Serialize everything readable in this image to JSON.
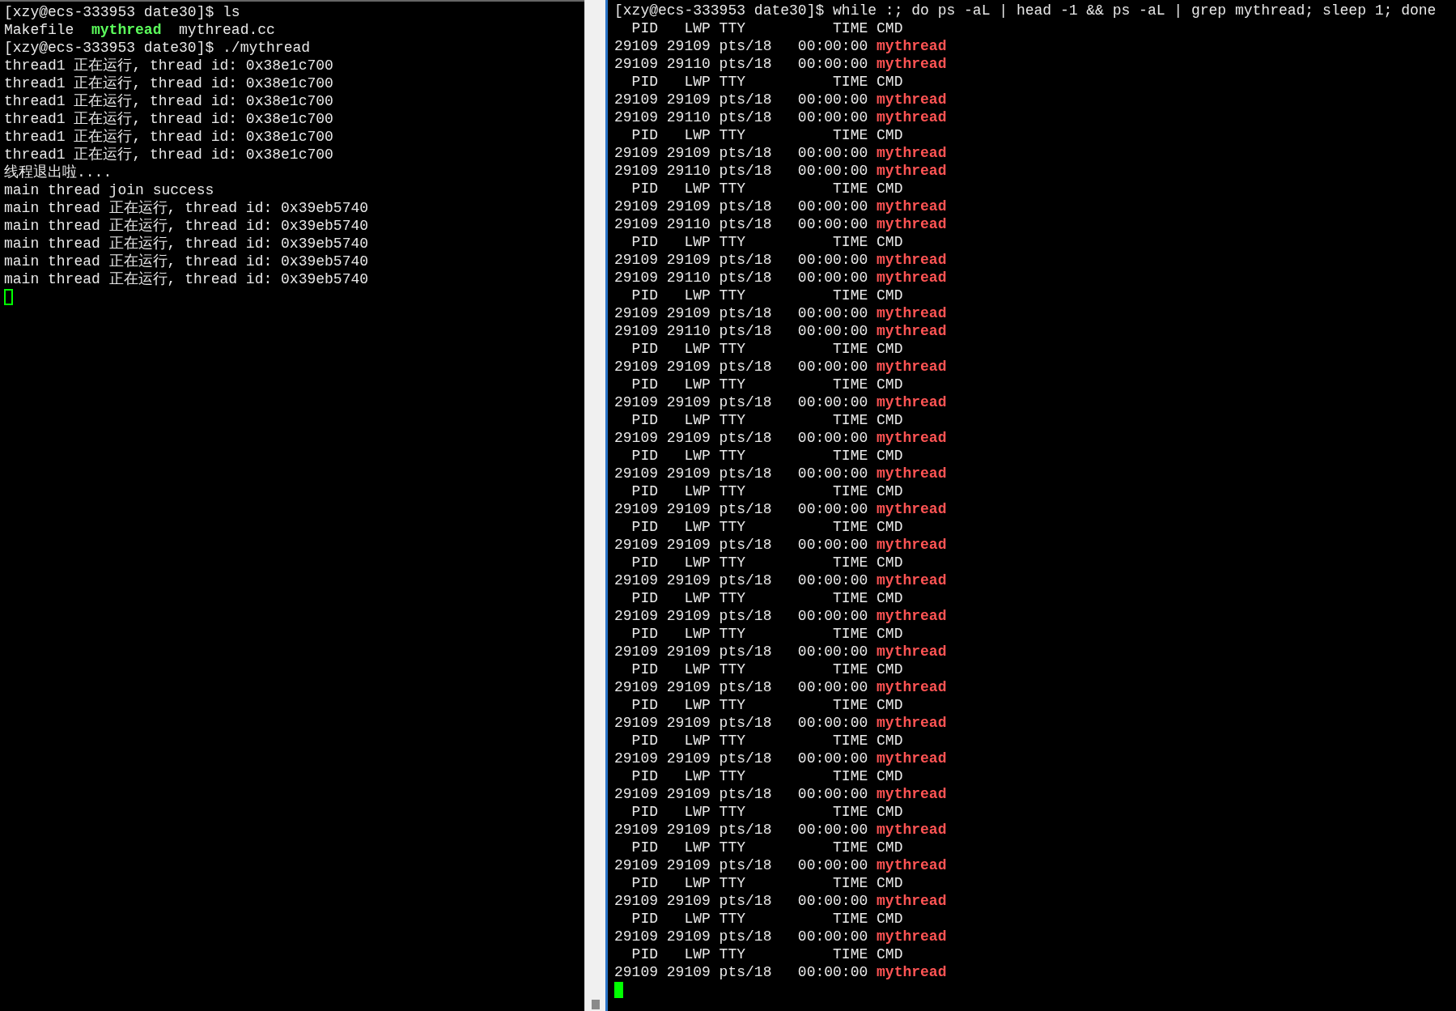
{
  "left_pane": {
    "lines": [
      [
        {
          "text": "[xzy@ecs-333953 date30]$ ls",
          "kind": "plain"
        }
      ],
      [
        {
          "text": "Makefile",
          "kind": "plain"
        },
        {
          "text": "mythread",
          "kind": "exec"
        },
        {
          "text": "mythread.cc",
          "kind": "plain"
        }
      ],
      [
        {
          "text": "[xzy@ecs-333953 date30]$ ./mythread",
          "kind": "plain"
        }
      ],
      [
        {
          "text": "thread1 正在运行, thread id: 0x38e1c700",
          "kind": "plain"
        }
      ],
      [
        {
          "text": "thread1 正在运行, thread id: 0x38e1c700",
          "kind": "plain"
        }
      ],
      [
        {
          "text": "thread1 正在运行, thread id: 0x38e1c700",
          "kind": "plain"
        }
      ],
      [
        {
          "text": "thread1 正在运行, thread id: 0x38e1c700",
          "kind": "plain"
        }
      ],
      [
        {
          "text": "thread1 正在运行, thread id: 0x38e1c700",
          "kind": "plain"
        }
      ],
      [
        {
          "text": "thread1 正在运行, thread id: 0x38e1c700",
          "kind": "plain"
        }
      ],
      [
        {
          "text": "线程退出啦....",
          "kind": "plain"
        }
      ],
      [
        {
          "text": "main thread join success",
          "kind": "plain"
        }
      ],
      [
        {
          "text": "main thread 正在运行, thread id: 0x39eb5740",
          "kind": "plain"
        }
      ],
      [
        {
          "text": "main thread 正在运行, thread id: 0x39eb5740",
          "kind": "plain"
        }
      ],
      [
        {
          "text": "main thread 正在运行, thread id: 0x39eb5740",
          "kind": "plain"
        }
      ],
      [
        {
          "text": "main thread 正在运行, thread id: 0x39eb5740",
          "kind": "plain"
        }
      ],
      [
        {
          "text": "main thread 正在运行, thread id: 0x39eb5740",
          "kind": "plain"
        }
      ]
    ],
    "cursor": {
      "filled": false
    }
  },
  "right_pane": {
    "lines": [
      [
        {
          "text": "[xzy@ecs-333953 date30]$ while :; do ps -aL | head -1 && ps -aL | grep mythread; sleep 1; done",
          "kind": "plain"
        }
      ],
      [
        {
          "text": "  PID   LWP TTY          TIME CMD",
          "kind": "plain"
        }
      ],
      [
        {
          "text": "29109 29109 pts/18   00:00:00 ",
          "kind": "plain"
        },
        {
          "text": "mythread",
          "kind": "proc"
        }
      ],
      [
        {
          "text": "29109 29110 pts/18   00:00:00 ",
          "kind": "plain"
        },
        {
          "text": "mythread",
          "kind": "proc"
        }
      ],
      [
        {
          "text": "  PID   LWP TTY          TIME CMD",
          "kind": "plain"
        }
      ],
      [
        {
          "text": "29109 29109 pts/18   00:00:00 ",
          "kind": "plain"
        },
        {
          "text": "mythread",
          "kind": "proc"
        }
      ],
      [
        {
          "text": "29109 29110 pts/18   00:00:00 ",
          "kind": "plain"
        },
        {
          "text": "mythread",
          "kind": "proc"
        }
      ],
      [
        {
          "text": "  PID   LWP TTY          TIME CMD",
          "kind": "plain"
        }
      ],
      [
        {
          "text": "29109 29109 pts/18   00:00:00 ",
          "kind": "plain"
        },
        {
          "text": "mythread",
          "kind": "proc"
        }
      ],
      [
        {
          "text": "29109 29110 pts/18   00:00:00 ",
          "kind": "plain"
        },
        {
          "text": "mythread",
          "kind": "proc"
        }
      ],
      [
        {
          "text": "  PID   LWP TTY          TIME CMD",
          "kind": "plain"
        }
      ],
      [
        {
          "text": "29109 29109 pts/18   00:00:00 ",
          "kind": "plain"
        },
        {
          "text": "mythread",
          "kind": "proc"
        }
      ],
      [
        {
          "text": "29109 29110 pts/18   00:00:00 ",
          "kind": "plain"
        },
        {
          "text": "mythread",
          "kind": "proc"
        }
      ],
      [
        {
          "text": "  PID   LWP TTY          TIME CMD",
          "kind": "plain"
        }
      ],
      [
        {
          "text": "29109 29109 pts/18   00:00:00 ",
          "kind": "plain"
        },
        {
          "text": "mythread",
          "kind": "proc"
        }
      ],
      [
        {
          "text": "29109 29110 pts/18   00:00:00 ",
          "kind": "plain"
        },
        {
          "text": "mythread",
          "kind": "proc"
        }
      ],
      [
        {
          "text": "  PID   LWP TTY          TIME CMD",
          "kind": "plain"
        }
      ],
      [
        {
          "text": "29109 29109 pts/18   00:00:00 ",
          "kind": "plain"
        },
        {
          "text": "mythread",
          "kind": "proc"
        }
      ],
      [
        {
          "text": "29109 29110 pts/18   00:00:00 ",
          "kind": "plain"
        },
        {
          "text": "mythread",
          "kind": "proc"
        }
      ],
      [
        {
          "text": "  PID   LWP TTY          TIME CMD",
          "kind": "plain"
        }
      ],
      [
        {
          "text": "29109 29109 pts/18   00:00:00 ",
          "kind": "plain"
        },
        {
          "text": "mythread",
          "kind": "proc"
        }
      ],
      [
        {
          "text": "  PID   LWP TTY          TIME CMD",
          "kind": "plain"
        }
      ],
      [
        {
          "text": "29109 29109 pts/18   00:00:00 ",
          "kind": "plain"
        },
        {
          "text": "mythread",
          "kind": "proc"
        }
      ],
      [
        {
          "text": "  PID   LWP TTY          TIME CMD",
          "kind": "plain"
        }
      ],
      [
        {
          "text": "29109 29109 pts/18   00:00:00 ",
          "kind": "plain"
        },
        {
          "text": "mythread",
          "kind": "proc"
        }
      ],
      [
        {
          "text": "  PID   LWP TTY          TIME CMD",
          "kind": "plain"
        }
      ],
      [
        {
          "text": "29109 29109 pts/18   00:00:00 ",
          "kind": "plain"
        },
        {
          "text": "mythread",
          "kind": "proc"
        }
      ],
      [
        {
          "text": "  PID   LWP TTY          TIME CMD",
          "kind": "plain"
        }
      ],
      [
        {
          "text": "29109 29109 pts/18   00:00:00 ",
          "kind": "plain"
        },
        {
          "text": "mythread",
          "kind": "proc"
        }
      ],
      [
        {
          "text": "  PID   LWP TTY          TIME CMD",
          "kind": "plain"
        }
      ],
      [
        {
          "text": "29109 29109 pts/18   00:00:00 ",
          "kind": "plain"
        },
        {
          "text": "mythread",
          "kind": "proc"
        }
      ],
      [
        {
          "text": "  PID   LWP TTY          TIME CMD",
          "kind": "plain"
        }
      ],
      [
        {
          "text": "29109 29109 pts/18   00:00:00 ",
          "kind": "plain"
        },
        {
          "text": "mythread",
          "kind": "proc"
        }
      ],
      [
        {
          "text": "  PID   LWP TTY          TIME CMD",
          "kind": "plain"
        }
      ],
      [
        {
          "text": "29109 29109 pts/18   00:00:00 ",
          "kind": "plain"
        },
        {
          "text": "mythread",
          "kind": "proc"
        }
      ],
      [
        {
          "text": "  PID   LWP TTY          TIME CMD",
          "kind": "plain"
        }
      ],
      [
        {
          "text": "29109 29109 pts/18   00:00:00 ",
          "kind": "plain"
        },
        {
          "text": "mythread",
          "kind": "proc"
        }
      ],
      [
        {
          "text": "  PID   LWP TTY          TIME CMD",
          "kind": "plain"
        }
      ],
      [
        {
          "text": "29109 29109 pts/18   00:00:00 ",
          "kind": "plain"
        },
        {
          "text": "mythread",
          "kind": "proc"
        }
      ],
      [
        {
          "text": "  PID   LWP TTY          TIME CMD",
          "kind": "plain"
        }
      ],
      [
        {
          "text": "29109 29109 pts/18   00:00:00 ",
          "kind": "plain"
        },
        {
          "text": "mythread",
          "kind": "proc"
        }
      ],
      [
        {
          "text": "  PID   LWP TTY          TIME CMD",
          "kind": "plain"
        }
      ],
      [
        {
          "text": "29109 29109 pts/18   00:00:00 ",
          "kind": "plain"
        },
        {
          "text": "mythread",
          "kind": "proc"
        }
      ],
      [
        {
          "text": "  PID   LWP TTY          TIME CMD",
          "kind": "plain"
        }
      ],
      [
        {
          "text": "29109 29109 pts/18   00:00:00 ",
          "kind": "plain"
        },
        {
          "text": "mythread",
          "kind": "proc"
        }
      ],
      [
        {
          "text": "  PID   LWP TTY          TIME CMD",
          "kind": "plain"
        }
      ],
      [
        {
          "text": "29109 29109 pts/18   00:00:00 ",
          "kind": "plain"
        },
        {
          "text": "mythread",
          "kind": "proc"
        }
      ],
      [
        {
          "text": "  PID   LWP TTY          TIME CMD",
          "kind": "plain"
        }
      ],
      [
        {
          "text": "29109 29109 pts/18   00:00:00 ",
          "kind": "plain"
        },
        {
          "text": "mythread",
          "kind": "proc"
        }
      ],
      [
        {
          "text": "  PID   LWP TTY          TIME CMD",
          "kind": "plain"
        }
      ],
      [
        {
          "text": "29109 29109 pts/18   00:00:00 ",
          "kind": "plain"
        },
        {
          "text": "mythread",
          "kind": "proc"
        }
      ],
      [
        {
          "text": "  PID   LWP TTY          TIME CMD",
          "kind": "plain"
        }
      ],
      [
        {
          "text": "29109 29109 pts/18   00:00:00 ",
          "kind": "plain"
        },
        {
          "text": "mythread",
          "kind": "proc"
        }
      ],
      [
        {
          "text": "  PID   LWP TTY          TIME CMD",
          "kind": "plain"
        }
      ],
      [
        {
          "text": "29109 29109 pts/18   00:00:00 ",
          "kind": "plain"
        },
        {
          "text": "mythread",
          "kind": "proc"
        }
      ]
    ],
    "cursor": {
      "filled": true
    }
  }
}
